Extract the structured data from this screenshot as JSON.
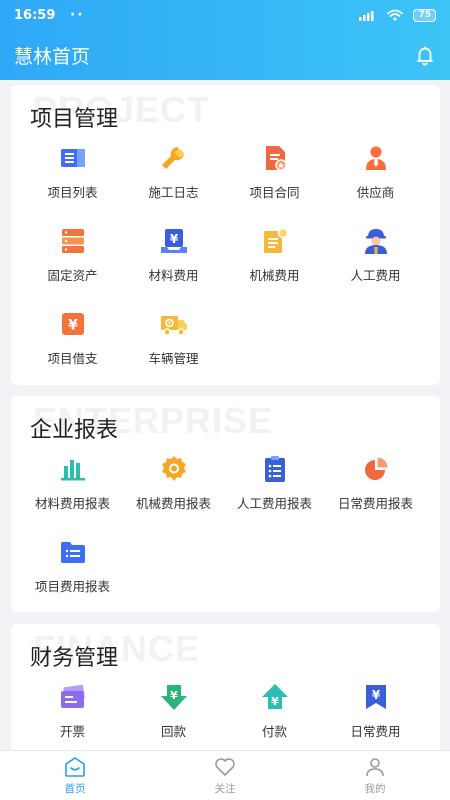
{
  "status": {
    "time": "16:59",
    "dots": "··",
    "battery": "75"
  },
  "header": {
    "title": "慧林首页"
  },
  "sections": [
    {
      "title": "项目管理",
      "bg_word": "PROJECT",
      "items": [
        {
          "label": "项目列表",
          "icon": "list-icon"
        },
        {
          "label": "施工日志",
          "icon": "wrench-icon"
        },
        {
          "label": "项目合同",
          "icon": "contract-icon"
        },
        {
          "label": "供应商",
          "icon": "supplier-icon"
        },
        {
          "label": "固定资产",
          "icon": "server-stack-icon"
        },
        {
          "label": "材料费用",
          "icon": "yuan-laptop-icon"
        },
        {
          "label": "机械费用",
          "icon": "machine-doc-icon"
        },
        {
          "label": "人工费用",
          "icon": "worker-icon"
        },
        {
          "label": "项目借支",
          "icon": "yuan-box-icon"
        },
        {
          "label": "车辆管理",
          "icon": "truck-icon"
        }
      ]
    },
    {
      "title": "企业报表",
      "bg_word": "ENTERPRISE",
      "items": [
        {
          "label": "材料费用报表",
          "icon": "bar-chart-icon"
        },
        {
          "label": "机械费用报表",
          "icon": "gear-icon"
        },
        {
          "label": "人工费用报表",
          "icon": "clipboard-icon"
        },
        {
          "label": "日常费用报表",
          "icon": "pie-chart-icon"
        },
        {
          "label": "项目费用报表",
          "icon": "folder-list-icon"
        }
      ]
    },
    {
      "title": "财务管理",
      "bg_word": "FINANCE",
      "items": [
        {
          "label": "开票",
          "icon": "invoice-icon"
        },
        {
          "label": "回款",
          "icon": "yuan-down-arrow-icon"
        },
        {
          "label": "付款",
          "icon": "yuan-up-arrow-icon"
        },
        {
          "label": "日常费用",
          "icon": "yuan-bookmark-icon"
        }
      ]
    }
  ],
  "tabbar": [
    {
      "label": "首页",
      "icon": "home-icon",
      "active": true
    },
    {
      "label": "关注",
      "icon": "heart-icon",
      "active": false
    },
    {
      "label": "我的",
      "icon": "user-icon",
      "active": false
    }
  ],
  "colors": {
    "header_start": "#2fa8f7",
    "header_end": "#3cc4f6",
    "tab_active": "#2a9df4"
  }
}
